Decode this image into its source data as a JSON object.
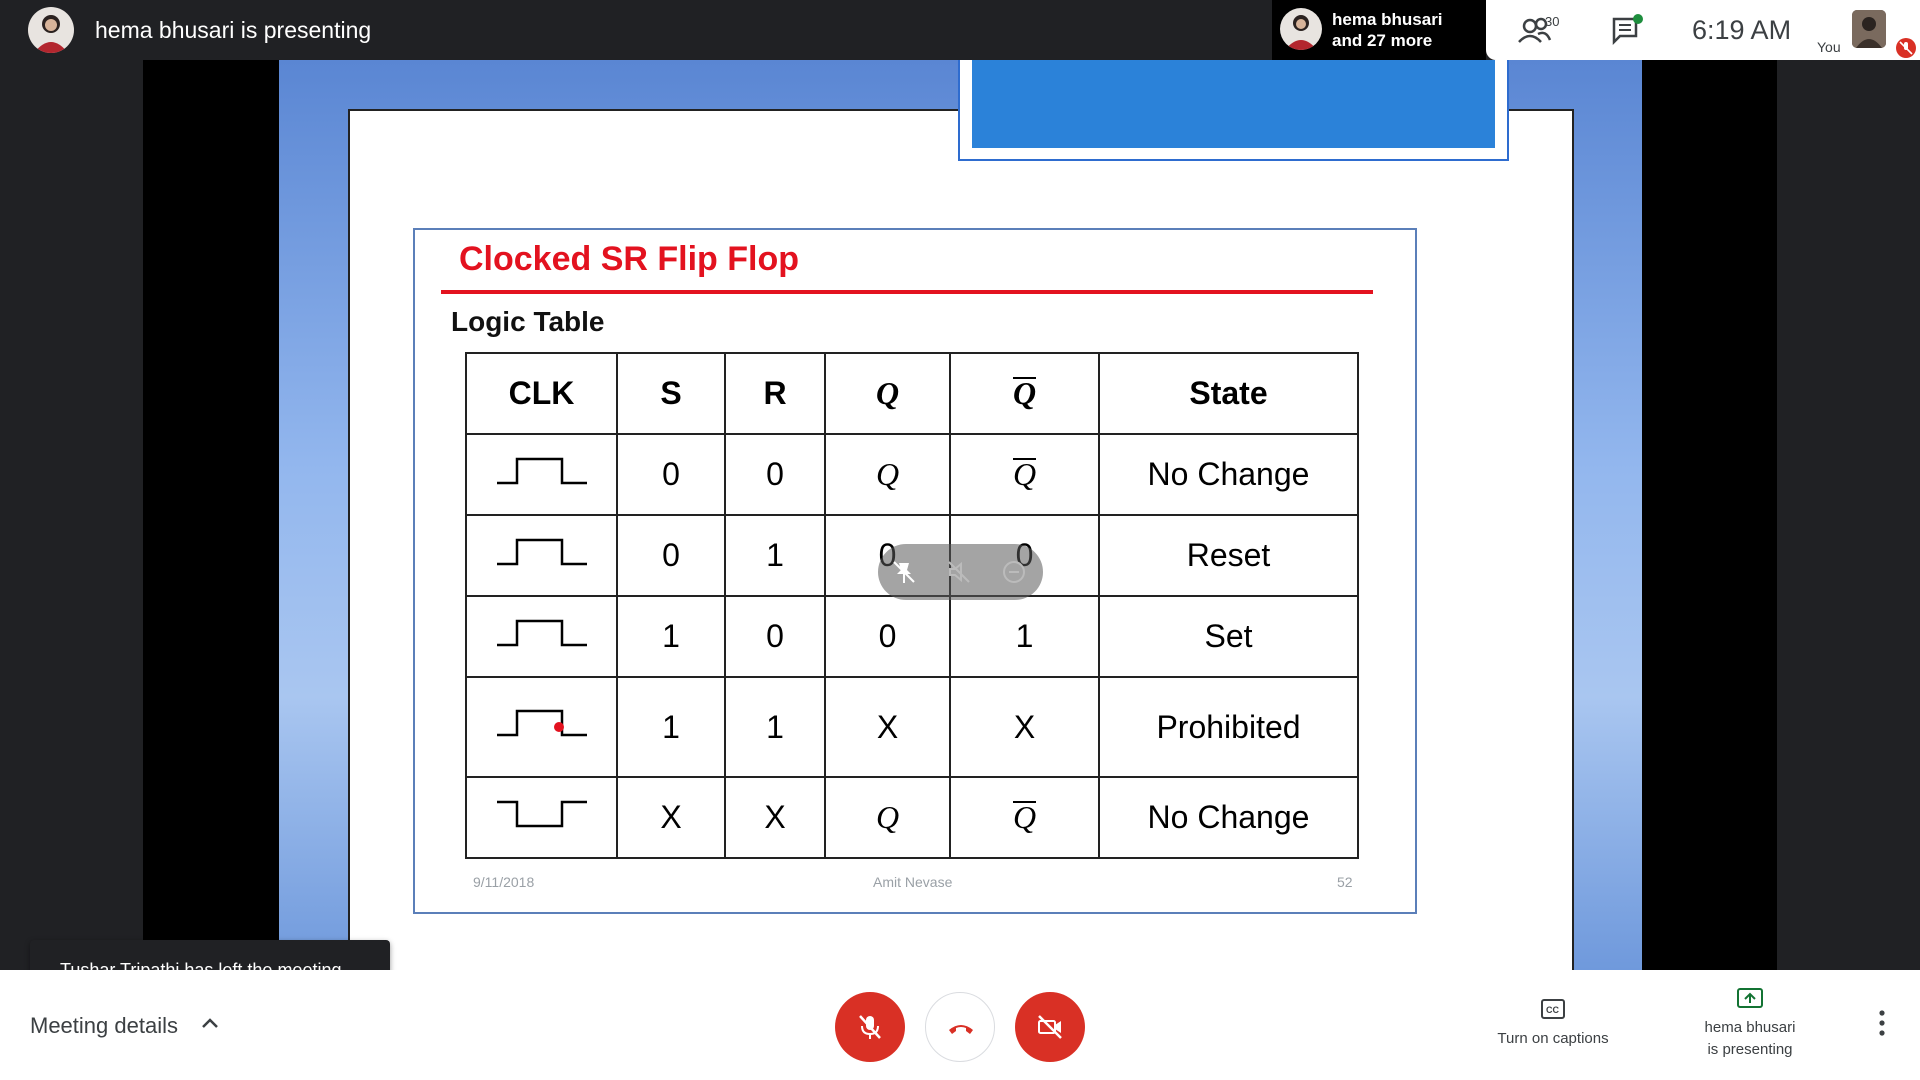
{
  "topbar": {
    "presenter_title": "hema bhusari is presenting",
    "tile_name_line1": "hema bhusari",
    "tile_name_line2": "and 27 more",
    "people_count": "30",
    "clock": "6:19  AM",
    "self_label": "You"
  },
  "slide": {
    "title": "Clocked SR Flip Flop",
    "subtitle": "Logic Table",
    "headers": [
      "CLK",
      "S",
      "R",
      "Q",
      "Q",
      "State"
    ],
    "rows": [
      {
        "clk": "rising-pulse",
        "s": "0",
        "r": "0",
        "q": "Q",
        "qbar": "Q",
        "state": "No Change"
      },
      {
        "clk": "rising-pulse",
        "s": "0",
        "r": "1",
        "q": "0",
        "qbar": "0",
        "state": "Reset"
      },
      {
        "clk": "rising-pulse",
        "s": "1",
        "r": "0",
        "q": "0",
        "qbar": "1",
        "state": "Set"
      },
      {
        "clk": "rising-pulse",
        "s": "1",
        "r": "1",
        "q": "X",
        "qbar": "X",
        "state": "Prohibited"
      },
      {
        "clk": "falling-pulse",
        "s": "X",
        "r": "X",
        "q": "Q",
        "qbar": "Q",
        "state": "No Change"
      }
    ],
    "footer_date": "9/11/2018",
    "footer_author": "Amit Nevase",
    "footer_page": "52"
  },
  "toast": {
    "text": "Tushar Tripathi has left the meeting"
  },
  "bottombar": {
    "meeting_details": "Meeting details",
    "captions_label": "Turn on captions",
    "present_line1": "hema bhusari",
    "present_line2": "is presenting"
  },
  "colors": {
    "accent_red": "#d93025",
    "slide_red": "#e3121f",
    "slide_blue": "#2b82d9"
  }
}
